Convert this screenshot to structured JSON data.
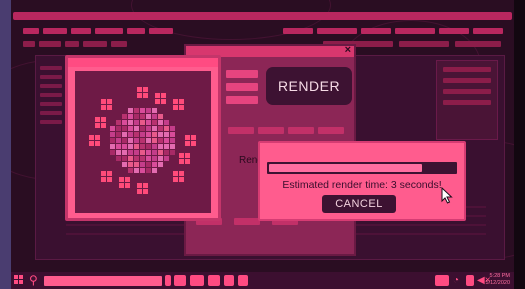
{
  "dialog": {
    "close_label": "×",
    "render_label": "RENDER",
    "field_label": "Rend"
  },
  "progress": {
    "value": 0.82,
    "message": "Estimated render time: 3 seconds!",
    "cancel_label": "CANCEL"
  },
  "taskbar": {
    "search_placeholder": "",
    "time": "5:28 PM",
    "date": "5/12/2020"
  },
  "colors": {
    "accent": "#ff5c8e",
    "dark": "#3d1232",
    "background": "#2a0d22"
  },
  "icons": [
    "start-icon",
    "search-icon",
    "mail-icon",
    "keyboard-icon",
    "folder-icon",
    "calendar-icon",
    "wifi-icon",
    "battery-icon",
    "volume-icon"
  ]
}
